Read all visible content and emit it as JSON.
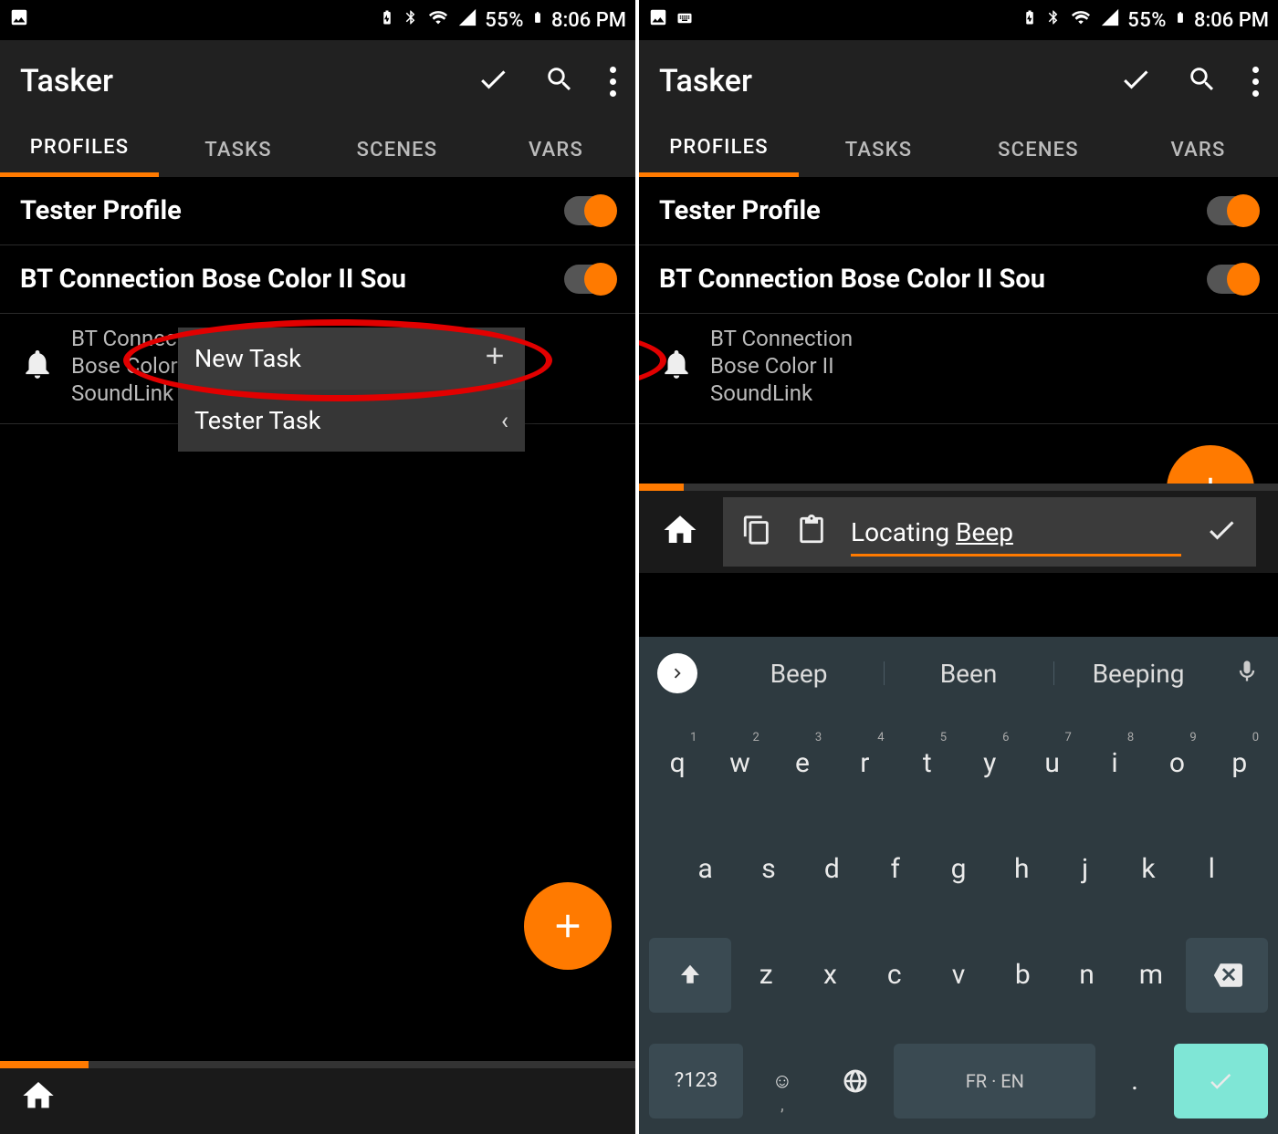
{
  "statusbar": {
    "battery_pct": "55%",
    "time": "8:06 PM"
  },
  "app": {
    "title": "Tasker"
  },
  "tabs": [
    "PROFILES",
    "TASKS",
    "SCENES",
    "VARS"
  ],
  "profiles": [
    {
      "name": "Tester Profile",
      "enabled": true
    },
    {
      "name": "BT Connection Bose Color II Sou",
      "enabled": true
    }
  ],
  "condition": {
    "line1": "BT Connection",
    "line2": "Bose Color II",
    "line3": "SoundLink"
  },
  "condition_left_trunc": {
    "line1": "BT Connec",
    "line2": "Bose Color",
    "line3": "SoundLink"
  },
  "ctxmenu": {
    "new_task": "New Task",
    "existing_task": "Tester Task"
  },
  "input": {
    "text_prefix": "Locating ",
    "text_under": "Beep"
  },
  "suggestions": [
    "Beep",
    "Been",
    "Beeping"
  ],
  "keyboard": {
    "row1": [
      "q",
      "w",
      "e",
      "r",
      "t",
      "y",
      "u",
      "i",
      "o",
      "p"
    ],
    "row1_sup": [
      "1",
      "2",
      "3",
      "4",
      "5",
      "6",
      "7",
      "8",
      "9",
      "0"
    ],
    "row2": [
      "a",
      "s",
      "d",
      "f",
      "g",
      "h",
      "j",
      "k",
      "l"
    ],
    "row3": [
      "z",
      "x",
      "c",
      "v",
      "b",
      "n",
      "m"
    ],
    "sym": "?123",
    "lang": "FR · EN",
    "period": "."
  }
}
